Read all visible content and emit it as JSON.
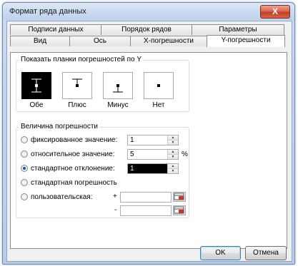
{
  "window": {
    "title": "Формат ряда данных",
    "close_label": "X"
  },
  "tabs_back": [
    {
      "label": "Подписи данных"
    },
    {
      "label": "Порядок рядов"
    },
    {
      "label": "Параметры"
    }
  ],
  "tabs_front": [
    {
      "label": "Вид"
    },
    {
      "label": "Ось"
    },
    {
      "label": "Х-погрешности"
    },
    {
      "label": "Y-погрешности",
      "active": true
    }
  ],
  "display": {
    "title": "Показать планки погрешностей по Y",
    "options": [
      {
        "label": "Обе",
        "icon": "error-bar-both-icon",
        "selected": true
      },
      {
        "label": "Плюс",
        "icon": "error-bar-plus-icon"
      },
      {
        "label": "Минус",
        "icon": "error-bar-minus-icon"
      },
      {
        "label": "Нет",
        "icon": "error-bar-none-icon"
      }
    ]
  },
  "amount": {
    "title": "Величина погрешности",
    "fixed": {
      "label": "фиксированное значение:",
      "value": "1"
    },
    "percent": {
      "label": "относительное значение:",
      "value": "5",
      "unit": "%"
    },
    "stdev": {
      "label": "стандартное отклонение:",
      "value": "1",
      "selected": true
    },
    "sterr": {
      "label": "стандартная погрешность"
    },
    "custom": {
      "label": "пользовательская:",
      "plus_sign": "+",
      "minus_sign": "-"
    }
  },
  "buttons": {
    "ok": "OK",
    "cancel": "Отмена"
  }
}
